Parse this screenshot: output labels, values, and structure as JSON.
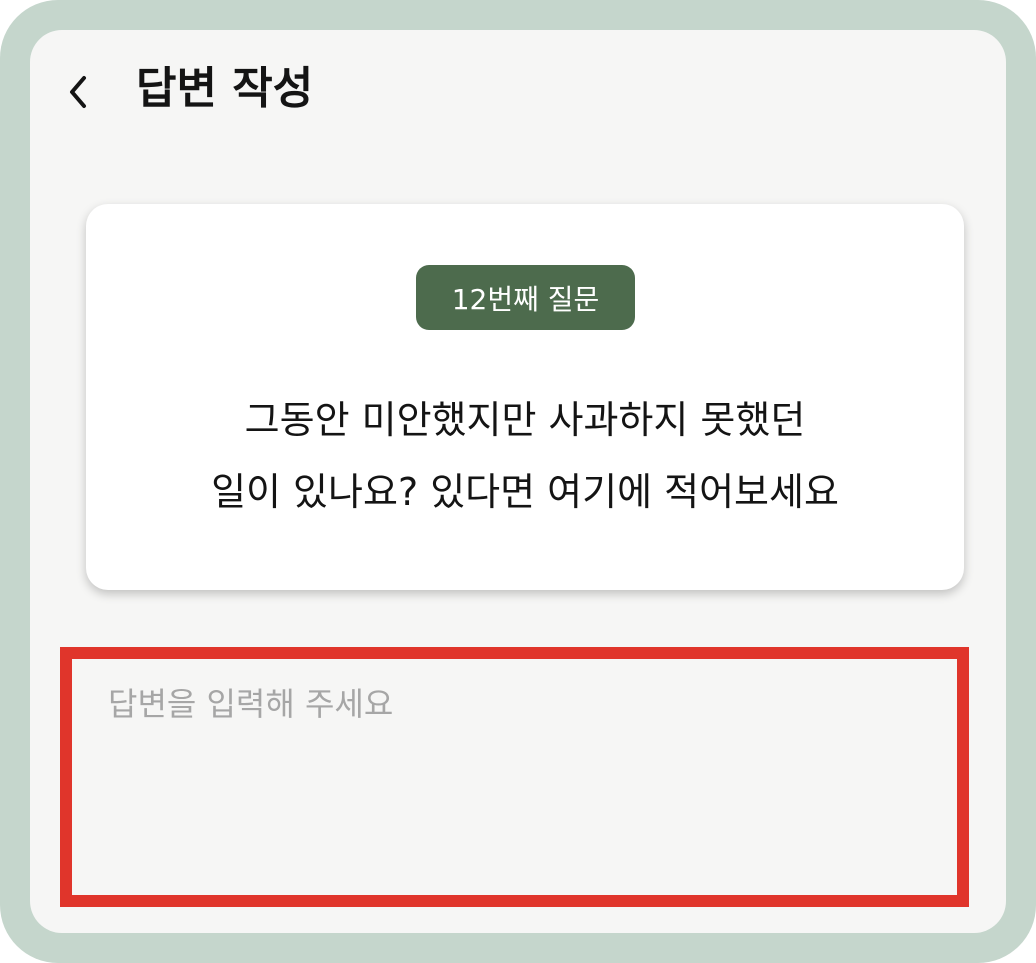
{
  "header": {
    "back_icon": "chevron-left-icon",
    "title": "답변 작성"
  },
  "question": {
    "badge": "12번째 질문",
    "lines": [
      "그동안 미안했지만 사과하지 못했던",
      "일이 있나요? 있다면 여기에 적어보세요"
    ]
  },
  "answer": {
    "value": "",
    "placeholder": "답변을 입력해 주세요"
  },
  "colors": {
    "frame": "#c5d6cc",
    "background": "#f6f6f5",
    "badge": "#4d6b4d",
    "highlight_border": "#e0352b",
    "placeholder": "#a6a6a6"
  }
}
